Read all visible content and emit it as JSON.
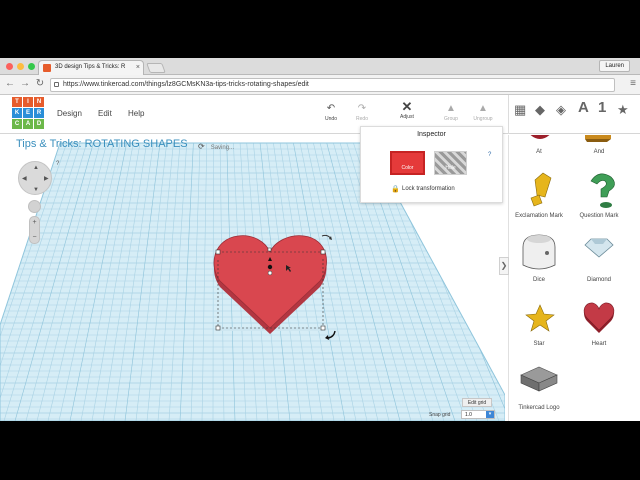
{
  "browser": {
    "tab_title": "3D design Tips & Tricks: R",
    "tab_close": "×",
    "user_name": "Lauren",
    "url": "https://www.tinkercad.com/things/lz8GCMsKN3a-tips-tricks-rotating-shapes/edit",
    "back_glyph": "←",
    "forward_glyph": "→",
    "reload_glyph": "↻",
    "menu_glyph": "≡"
  },
  "app": {
    "logo_letters": [
      "T",
      "I",
      "N",
      "K",
      "E",
      "R",
      "C",
      "A",
      "D"
    ],
    "menu": {
      "design": "Design",
      "edit": "Edit",
      "help": "Help"
    },
    "toolbar": {
      "undo": "Undo",
      "redo": "Redo",
      "adjust": "Adjust",
      "group": "Group",
      "ungroup": "Ungroup"
    },
    "view_icons": [
      "grid-view-icon",
      "box-icon",
      "box-icon-alt",
      "letter-a-icon",
      "number-1-icon",
      "star-icon"
    ],
    "view_glyphs": {
      "a": "A",
      "one": "1",
      "star": "★"
    }
  },
  "design": {
    "title": "Tips & Tricks: ROTATING SHAPES",
    "saving_text": "Saving...",
    "help_q": "?"
  },
  "inspector": {
    "title": "Inspector",
    "color_label": "Color",
    "hole_label": "Hole",
    "help": "?",
    "lock_label": "Lock transformation",
    "color_hex": "#e53a3a"
  },
  "shapes_panel": {
    "items": [
      {
        "label": "At"
      },
      {
        "label": "And"
      },
      {
        "label": "Exclamation Mark"
      },
      {
        "label": "Question Mark"
      },
      {
        "label": "Dice"
      },
      {
        "label": "Diamond"
      },
      {
        "label": "Star"
      },
      {
        "label": "Heart"
      },
      {
        "label": "Tinkercad Logo"
      }
    ]
  },
  "grid_controls": {
    "edit_grid": "Edit grid",
    "snap_label": "Snap grid",
    "snap_value": "1.0"
  },
  "colors": {
    "heart_red": "#d9474f",
    "title_blue": "#3a8fbd",
    "grid_blue": "#bfe0ee",
    "logo_orange": "#e65c2c",
    "logo_blue": "#2a8fd8",
    "logo_green": "#6cb84a"
  }
}
